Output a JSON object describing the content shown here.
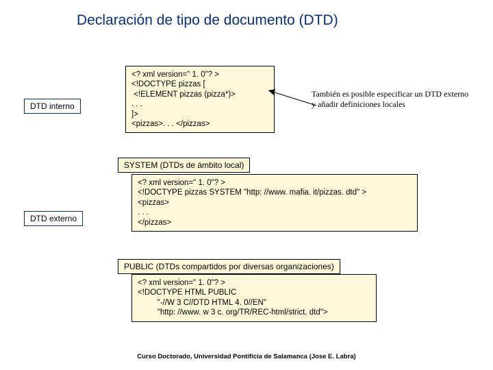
{
  "title": "Declaración de tipo de documento (DTD)",
  "labels": {
    "interno": "DTD interno",
    "externo": "DTD externo"
  },
  "code1": "<? xml version=\" 1. 0\"? >\n<!DOCTYPE pizzas [\n <!ELEMENT pizzas (pizza*)>\n. . .\n]>\n<pizzas>. . . </pizzas>",
  "note": "También es posible especificar un\nDTD externo y añadir definiciones\nlocales",
  "section_system": "SYSTEM (DTDs de ámbito local)",
  "code2": "<? xml version=\" 1. 0\"? >\n<!DOCTYPE pizzas SYSTEM \"http: //www. mafia. it/pizzas. dtd\" >\n<pizzas>\n. . .\n</pizzas>",
  "section_public": "PUBLIC (DTDs compartidos por diversas organizaciones)",
  "code3": "<? xml version=\" 1. 0\"? >\n<!DOCTYPE HTML PUBLIC\n         \"-//W 3 C//DTD HTML 4. 0//EN\"\n         \"http: //www. w 3 c. org/TR/REC-html/strict. dtd\">",
  "footer": "Curso Doctorado, Universidad Pontificia de Salamanca (Jose E. Labra)"
}
